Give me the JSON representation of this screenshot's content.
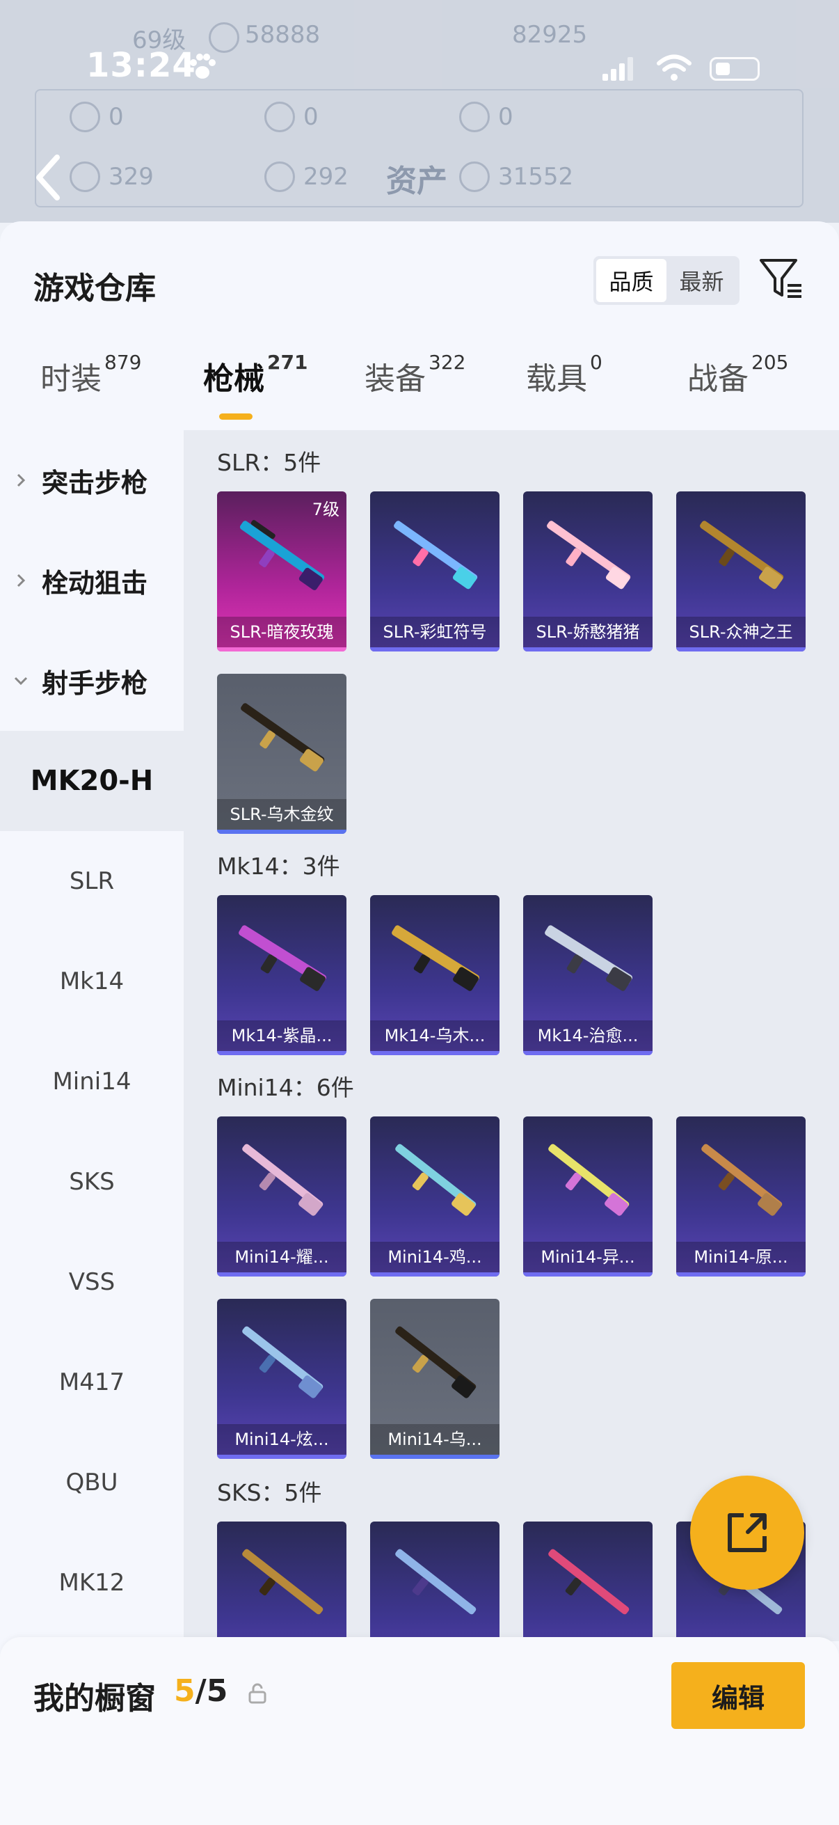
{
  "status_bar": {
    "time": "13:24"
  },
  "background": {
    "level": "69级",
    "stat_top": "58888",
    "stat_right": "82925",
    "row1": [
      "0",
      "0",
      "0"
    ],
    "row2_left": "329",
    "row2_mid": "292",
    "title": "资产",
    "row2_right": "31552"
  },
  "header": {
    "title": "游戏仓库",
    "sort_options": [
      "品质",
      "最新"
    ],
    "sort_selected": "品质"
  },
  "tabs": [
    {
      "label": "时装",
      "count": "879"
    },
    {
      "label": "枪械",
      "count": "271",
      "active": true
    },
    {
      "label": "装备",
      "count": "322"
    },
    {
      "label": "载具",
      "count": "0"
    },
    {
      "label": "战备",
      "count": "205"
    }
  ],
  "sidebar": {
    "categories": [
      "突击步枪",
      "栓动狙击",
      "射手步枪"
    ],
    "subitems": [
      "MK20-H",
      "SLR",
      "Mk14",
      "Mini14",
      "SKS",
      "VSS",
      "M417",
      "QBU",
      "MK12"
    ]
  },
  "groups": [
    {
      "title": "SLR：5件",
      "items": [
        {
          "name": "SLR-暗夜玫瑰",
          "level": "7级",
          "style": "pink"
        },
        {
          "name": "SLR-彩虹符号",
          "style": "purple"
        },
        {
          "name": "SLR-娇憨猪猪",
          "style": "purple"
        },
        {
          "name": "SLR-众神之王",
          "style": "purple"
        },
        {
          "name": "SLR-乌木金纹",
          "style": "gray"
        }
      ]
    },
    {
      "title": "Mk14：3件",
      "items": [
        {
          "name": "Mk14-紫晶...",
          "style": "purple"
        },
        {
          "name": "Mk14-乌木...",
          "style": "purple"
        },
        {
          "name": "Mk14-治愈...",
          "style": "purple"
        }
      ]
    },
    {
      "title": "Mini14：6件",
      "items": [
        {
          "name": "Mini14-耀...",
          "style": "purple"
        },
        {
          "name": "Mini14-鸡...",
          "style": "purple"
        },
        {
          "name": "Mini14-异...",
          "style": "purple"
        },
        {
          "name": "Mini14-原...",
          "style": "purple"
        },
        {
          "name": "Mini14-炫...",
          "style": "purple"
        },
        {
          "name": "Mini14-乌...",
          "style": "gray"
        }
      ]
    },
    {
      "title": "SKS：5件",
      "items": [
        {
          "name": "",
          "style": "purple"
        },
        {
          "name": "",
          "style": "purple"
        },
        {
          "name": "",
          "style": "purple"
        },
        {
          "name": "",
          "style": "purple"
        }
      ]
    }
  ],
  "bottom_bar": {
    "label": "我的橱窗",
    "current": "5",
    "separator": "/",
    "total": "5",
    "edit_label": "编辑"
  },
  "colors": {
    "accent": "#f5b01c",
    "purple_card": "#3e3690",
    "pink_card": "#b0259a",
    "gray_card": "#6b717e"
  },
  "icons": [
    "paw-icon",
    "signal-icon",
    "wifi-icon",
    "battery-icon",
    "back-icon",
    "filter-icon",
    "chevron-right-icon",
    "chevron-down-icon",
    "share-icon",
    "lock-icon",
    "rifle-icon"
  ]
}
